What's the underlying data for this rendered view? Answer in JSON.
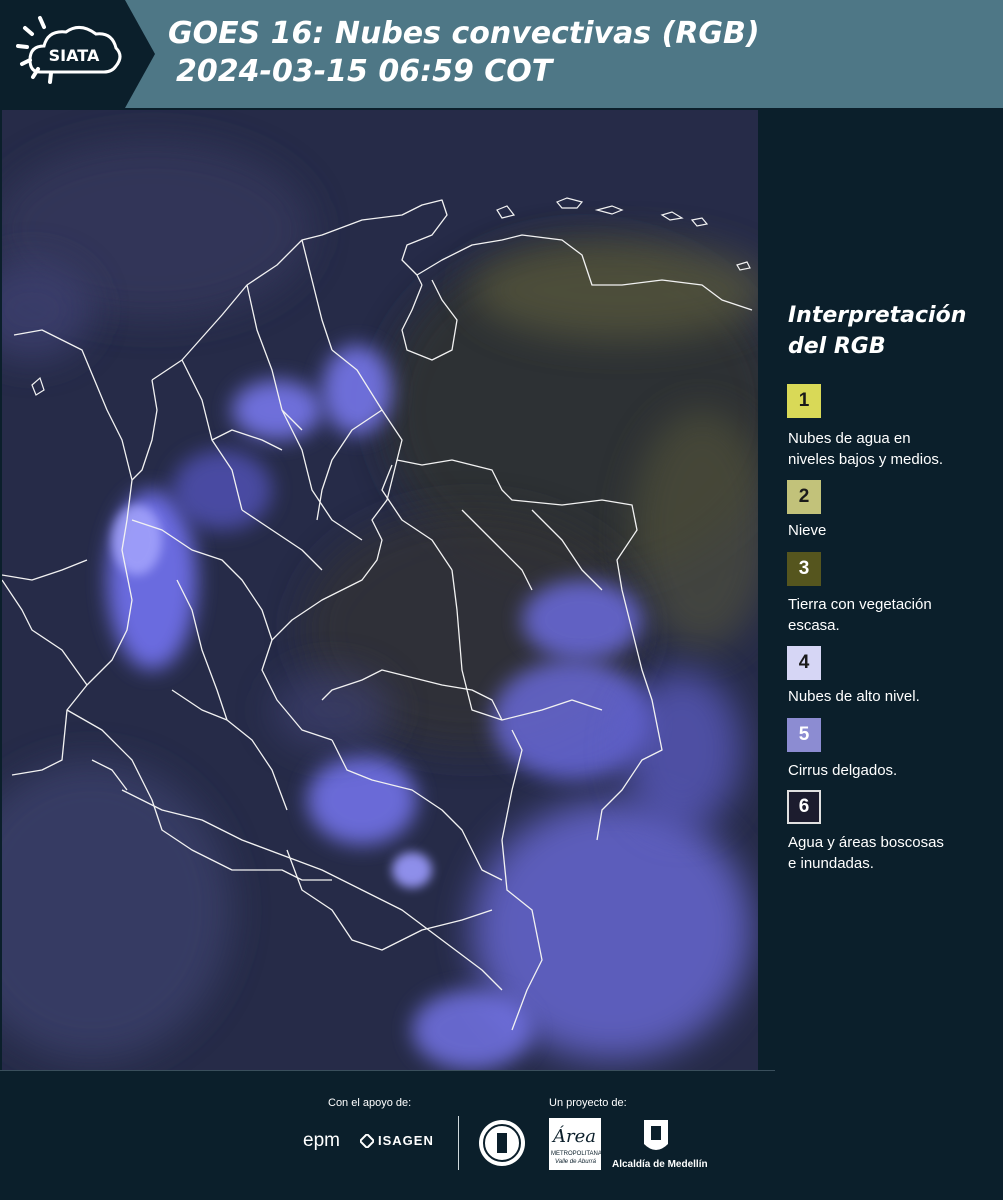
{
  "header": {
    "logo_text": "SIATA",
    "title_line1": "GOES 16: Nubes convectivas (RGB)",
    "title_line2": "2024-03-15 06:59 COT"
  },
  "legend": {
    "title_line1": "Interpretación",
    "title_line2": "del RGB",
    "items": [
      {
        "number": "1",
        "color": "#d9d957",
        "line1": "Nubes de agua en",
        "line2": "niveles bajos y medios."
      },
      {
        "number": "2",
        "color": "#c2c27a",
        "line1": "Nieve",
        "line2": ""
      },
      {
        "number": "3",
        "color": "#55551e",
        "line1": "Tierra con vegetación",
        "line2": "escasa."
      },
      {
        "number": "4",
        "color": "#d6d6f5",
        "line1": "Nubes de alto nivel.",
        "line2": ""
      },
      {
        "number": "5",
        "color": "#8c8cd2",
        "line1": "Cirrus delgados.",
        "line2": ""
      },
      {
        "number": "6",
        "color": "#1c1c2e",
        "line1": "Agua y áreas boscosas",
        "line2": "e inundadas."
      }
    ]
  },
  "footer": {
    "support_label": "Con el apoyo de:",
    "sponsor1": "epm",
    "sponsor2": "ISAGEN",
    "project_label": "Un proyecto de:",
    "area_logo": "Área",
    "area_sub1": "METROPOLITANA",
    "area_sub2": "Valle de Aburrá",
    "alcaldia": "Alcaldía de Medellín"
  }
}
